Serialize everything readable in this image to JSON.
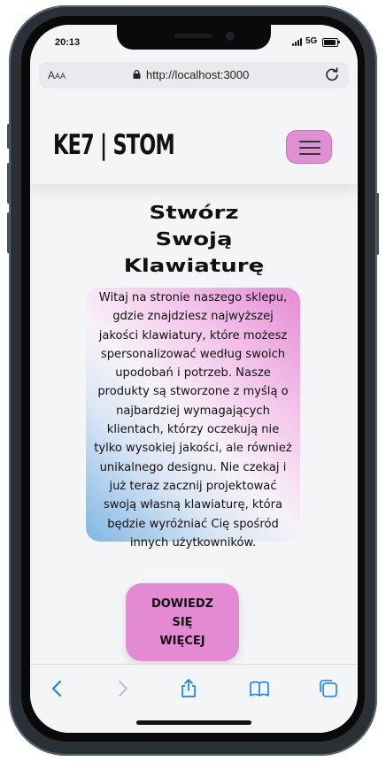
{
  "status_bar": {
    "time": "20:13",
    "network": "5G"
  },
  "browser": {
    "text_size_label": "AA",
    "url": "http://localhost:3000"
  },
  "header": {
    "logo": "KE7 | STOM"
  },
  "hero": {
    "title_lines": [
      "Stwórz",
      "Swoją",
      "Klawiaturę"
    ],
    "description_lines": [
      "Witaj na stronie naszego sklepu,",
      "gdzie znajdziesz najwyższej",
      "jakości klawiatury, które możesz",
      "spersonalizować według swoich",
      "upodobań i potrzeb. Nasze",
      "produkty są stworzone z myślą o",
      "najbardziej wymagających",
      "klientach, którzy oczekują nie",
      "tylko wysokiej jakości, ale również",
      "unikalnego designu. Nie czekaj i",
      "już teraz zacznij projektować",
      "swoją własną klawiaturę, która",
      "będzie wyróżniać Cię spośród",
      "innych użytkowników."
    ],
    "cta_lines": [
      "DOWIEDZ",
      "SIĘ",
      "WIĘCEJ"
    ]
  },
  "icons": {
    "menu": "hamburger-icon",
    "back": "chevron-left-icon",
    "forward": "chevron-right-icon",
    "share": "share-icon",
    "bookmarks": "book-icon",
    "tabs": "tabs-icon",
    "lock": "lock-icon",
    "reload": "reload-icon"
  },
  "colors": {
    "accent_pink": "#e48ad3",
    "gradient_blue": "#7fb6e3",
    "ios_blue": "#1a7ff0"
  }
}
